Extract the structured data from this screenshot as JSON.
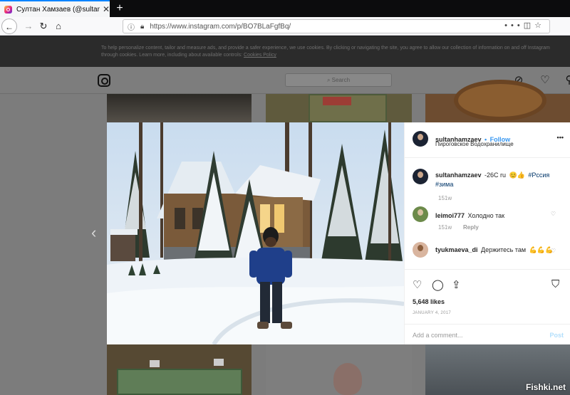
{
  "browser": {
    "tab_title": "Султан Хамзаев (@sultanhamzaev)",
    "tab_close": "✕",
    "new_tab": "+",
    "url": "https://www.instagram.com/p/BO7BLaFgfBq/",
    "more_dots": "•••"
  },
  "cookie_banner": {
    "text": "To help personalize content, tailor and measure ads, and provide a safer experience, we use cookies. By clicking or navigating the site, you agree to allow our collection of information on and off Instagram through cookies. Learn more, including about available controls: ",
    "link": "Cookies Policy"
  },
  "header": {
    "search_placeholder": "Search"
  },
  "post": {
    "username": "sultanhamzaev",
    "follow_label": "Follow",
    "separator": "•",
    "location": "Пироговское Водохранилище",
    "more": "•••",
    "caption_text": "-26C ru",
    "caption_emoji": "😊👍",
    "caption_tags": "#Рсcия #зима",
    "caption_time": "151w",
    "comments": [
      {
        "user": "leimoi777",
        "text": "Холодно так",
        "time": "151w",
        "reply": "Reply"
      },
      {
        "user": "tyukmaeva_di",
        "text": "Держитесь там",
        "emoji": "💪💪💪"
      }
    ],
    "likes": "5,648 likes",
    "date": "JANUARY 4, 2017",
    "add_comment_placeholder": "Add a comment...",
    "post_button": "Post"
  },
  "watermark": "Fishki.net"
}
